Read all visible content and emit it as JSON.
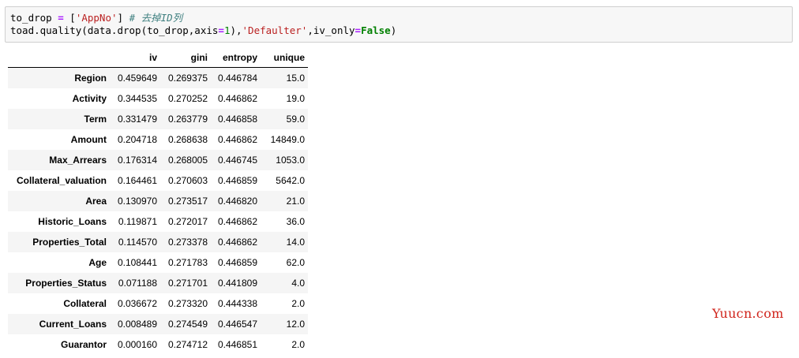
{
  "code": {
    "line1": {
      "var": "to_drop ",
      "eq": "=",
      "open": " [",
      "str": "'AppNo'",
      "close": "] ",
      "comment": "# 去掉ID列"
    },
    "line2": {
      "prefix": "toad.quality(data.drop(to_drop,axis",
      "eq1": "=",
      "num": "1",
      "mid": "),",
      "str": "'Defaulter'",
      "mid2": ",iv_only",
      "eq2": "=",
      "kw": "False",
      "close": ")"
    }
  },
  "table": {
    "columns": [
      "",
      "iv",
      "gini",
      "entropy",
      "unique"
    ],
    "rows": [
      {
        "name": "Region",
        "iv": "0.459649",
        "gini": "0.269375",
        "entropy": "0.446784",
        "unique": "15.0"
      },
      {
        "name": "Activity",
        "iv": "0.344535",
        "gini": "0.270252",
        "entropy": "0.446862",
        "unique": "19.0"
      },
      {
        "name": "Term",
        "iv": "0.331479",
        "gini": "0.263779",
        "entropy": "0.446858",
        "unique": "59.0"
      },
      {
        "name": "Amount",
        "iv": "0.204718",
        "gini": "0.268638",
        "entropy": "0.446862",
        "unique": "14849.0"
      },
      {
        "name": "Max_Arrears",
        "iv": "0.176314",
        "gini": "0.268005",
        "entropy": "0.446745",
        "unique": "1053.0"
      },
      {
        "name": "Collateral_valuation",
        "iv": "0.164461",
        "gini": "0.270603",
        "entropy": "0.446859",
        "unique": "5642.0"
      },
      {
        "name": "Area",
        "iv": "0.130970",
        "gini": "0.273517",
        "entropy": "0.446820",
        "unique": "21.0"
      },
      {
        "name": "Historic_Loans",
        "iv": "0.119871",
        "gini": "0.272017",
        "entropy": "0.446862",
        "unique": "36.0"
      },
      {
        "name": "Properties_Total",
        "iv": "0.114570",
        "gini": "0.273378",
        "entropy": "0.446862",
        "unique": "14.0"
      },
      {
        "name": "Age",
        "iv": "0.108441",
        "gini": "0.271783",
        "entropy": "0.446859",
        "unique": "62.0"
      },
      {
        "name": "Properties_Status",
        "iv": "0.071188",
        "gini": "0.271701",
        "entropy": "0.441809",
        "unique": "4.0"
      },
      {
        "name": "Collateral",
        "iv": "0.036672",
        "gini": "0.273320",
        "entropy": "0.444338",
        "unique": "2.0"
      },
      {
        "name": "Current_Loans",
        "iv": "0.008489",
        "gini": "0.274549",
        "entropy": "0.446547",
        "unique": "12.0"
      },
      {
        "name": "Guarantor",
        "iv": "0.000160",
        "gini": "0.274712",
        "entropy": "0.446851",
        "unique": "2.0"
      }
    ]
  },
  "watermark": "Yuucn.com",
  "colors": {
    "code_bg": "#f7f7f7",
    "code_border": "#cfcfcf",
    "string": "#ba2121",
    "operator": "#aa22ff",
    "comment": "#408080",
    "keyword": "#008000",
    "row_stripe": "#f5f5f5",
    "watermark": "#d0241b"
  }
}
